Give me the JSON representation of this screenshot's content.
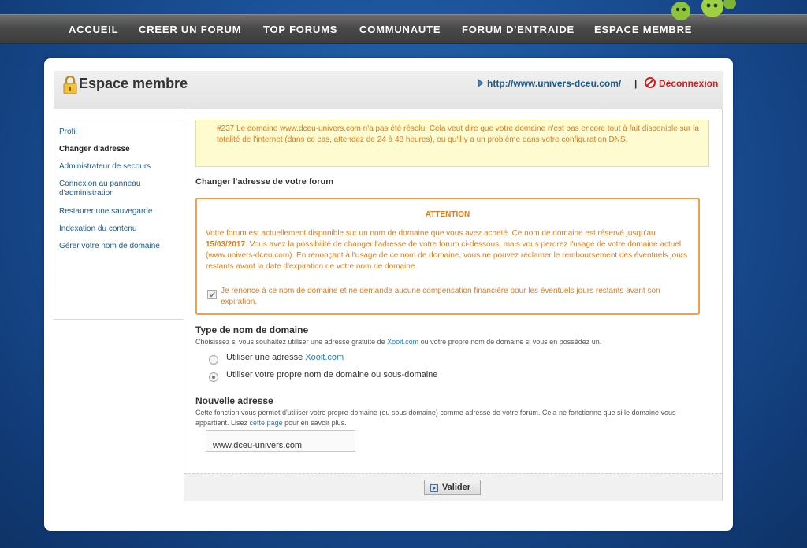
{
  "nav": {
    "items": [
      "ACCUEIL",
      "CREER UN FORUM",
      "TOP FORUMS",
      "COMMUNAUTE",
      "FORUM D'ENTRAIDE",
      "ESPACE MEMBRE"
    ]
  },
  "header": {
    "title": "Espace membre",
    "site_link": "http://www.univers-dceu.com/",
    "separator": "|",
    "logout": "Déconnexion"
  },
  "sidebar": {
    "items": [
      {
        "label": "Profil",
        "active": false
      },
      {
        "label": "Changer d'adresse",
        "active": true
      },
      {
        "label": "Administrateur de secours",
        "active": false
      },
      {
        "label": "Connexion au panneau d'administration",
        "active": false
      },
      {
        "label": "Restaurer une sauvegarde",
        "active": false
      },
      {
        "label": "Indexation du contenu",
        "active": false
      },
      {
        "label": "Gérer votre nom de domaine",
        "active": false
      }
    ]
  },
  "warning": {
    "text": "#237 Le domaine www.dceu-univers.com n'a pas été résolu. Cela veut dire que votre domaine n'est pas encore tout à fait disponible sur la totalité de l'internet (dans ce cas, attendez de 24 à 48 heures), ou qu'il y a un problème dans votre configuration DNS."
  },
  "section": {
    "title": "Changer l'adresse de votre forum"
  },
  "attention": {
    "title": "ATTENTION",
    "body_before": "Votre forum est actuellement disponible sur un nom de domaine que vous avez acheté. Ce nom de domaine est réservé jusqu'au ",
    "date": "15/03/2017",
    "body_after": ". Vous avez la possibilité de changer l'adresse de votre forum ci-dessous, mais vous perdrez l'usage de votre domaine actuel (www.univers-dceu.com). En renonçant à l'usage de ce nom de domaine, vous ne pouvez réclamer le remboursement des éventuels jours restants avant la date d'expiration de votre nom de domaine.",
    "checkbox_label": "Je renonce à ce nom de domaine et ne demande aucune compensation financière pour les éventuels jours restants avant son expiration.",
    "checkbox_checked": true
  },
  "domain_type": {
    "title": "Type de nom de domaine",
    "desc_before": "Choisissez si vous souhaitez utiliser une adresse gratuite de ",
    "desc_link": "Xooit.com",
    "desc_after": " ou votre propre nom de domaine si vous en possédez un.",
    "option1_text": "Utiliser une adresse ",
    "option1_link": "Xooit.com",
    "option2": "Utiliser votre propre nom de domaine ou sous-domaine",
    "selected": 2
  },
  "new_address": {
    "title": "Nouvelle adresse",
    "desc_before": "Cette fonction vous permet d'utiliser votre propre domaine (ou sous domaine) comme adresse de votre forum. Cela ne fonctionne que si le domaine vous appartient. Lisez ",
    "desc_link": "cette page",
    "desc_after": " pour en savoir plus.",
    "value": "www.dceu-univers.com"
  },
  "footer": {
    "validate": "Valider"
  },
  "colors": {
    "accent_orange": "#e07b1c",
    "link_blue": "#1a5c8f",
    "logout_red": "#d01b1b"
  }
}
